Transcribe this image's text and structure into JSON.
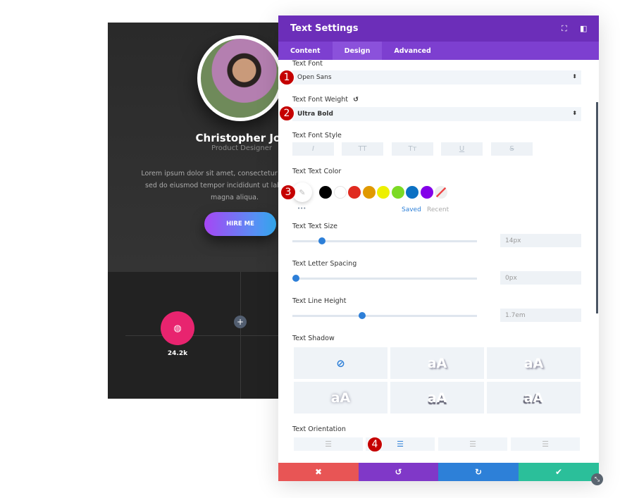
{
  "card": {
    "name": "Christopher Joe",
    "role": "Product Designer",
    "bio": "Lorem ipsum dolor sit amet, consectetur adipiscing elit, sed do eiusmod tempor incididunt ut labore et dolore magna aliqua.",
    "button": "HIRE ME",
    "social_count": "24.2k",
    "social_icon": "dribbble-icon",
    "add_icon": "plus-icon"
  },
  "panel": {
    "title": "Text Settings",
    "tabs": [
      {
        "label": "Content"
      },
      {
        "label": "Design",
        "active": true
      },
      {
        "label": "Advanced"
      }
    ],
    "font": {
      "label": "Text Font",
      "value": "Open Sans"
    },
    "weight": {
      "label": "Text Font Weight",
      "value": "Ultra Bold"
    },
    "style": {
      "label": "Text Font Style",
      "buttons": [
        "I",
        "TT",
        "Tт",
        "U",
        "S"
      ]
    },
    "color": {
      "label": "Text Text Color",
      "swatches": [
        "#000000",
        "#ffffff",
        "#e02b20",
        "#e09900",
        "#edf000",
        "#7cda24",
        "#0c71c3",
        "#8300e9"
      ],
      "saved": "Saved",
      "recent": "Recent",
      "more": "•••"
    },
    "size": {
      "label": "Text Text Size",
      "value": "14px",
      "level": 0.14
    },
    "spacing": {
      "label": "Text Letter Spacing",
      "value": "0px",
      "level": 0.0
    },
    "line_height": {
      "label": "Text Line Height",
      "value": "1.7em",
      "level": 0.36
    },
    "shadow": {
      "label": "Text Shadow",
      "sample": "aA"
    },
    "orientation": {
      "label": "Text Orientation",
      "selected": "center"
    },
    "footer": {
      "colors": [
        "#e85555",
        "#8038c8",
        "#2d80d8",
        "#2bbf9a"
      ]
    },
    "badges": [
      "1",
      "2",
      "3",
      "4"
    ]
  }
}
